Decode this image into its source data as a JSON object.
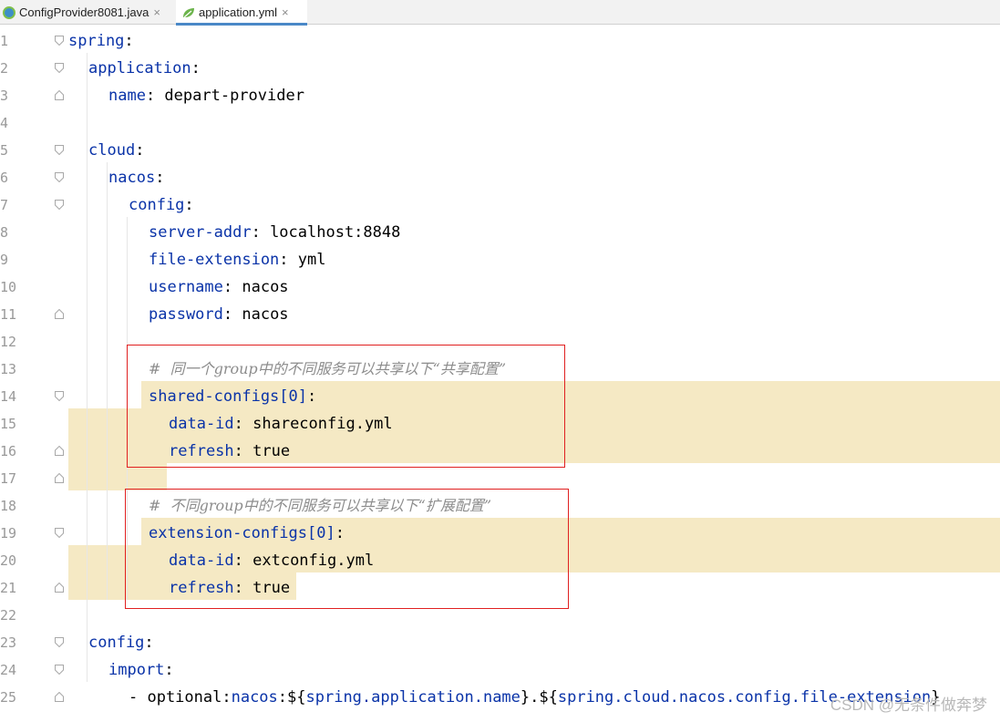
{
  "tabs": [
    {
      "label": "ConfigProvider8081.java",
      "active": false,
      "icon": "java-class-icon"
    },
    {
      "label": "application.yml",
      "active": true,
      "icon": "yaml-leaf-icon"
    }
  ],
  "close_glyph": "×",
  "lines": [
    {
      "n": "1",
      "indent": 0,
      "segs": [
        [
          "k",
          "spring"
        ],
        [
          "v",
          ":"
        ]
      ]
    },
    {
      "n": "2",
      "indent": 1,
      "segs": [
        [
          "k",
          "application"
        ],
        [
          "v",
          ":"
        ]
      ]
    },
    {
      "n": "3",
      "indent": 2,
      "segs": [
        [
          "k",
          "name"
        ],
        [
          "v",
          ": depart-provider"
        ]
      ]
    },
    {
      "n": "4",
      "indent": 0,
      "segs": []
    },
    {
      "n": "5",
      "indent": 1,
      "segs": [
        [
          "k",
          "cloud"
        ],
        [
          "v",
          ":"
        ]
      ]
    },
    {
      "n": "6",
      "indent": 2,
      "segs": [
        [
          "k",
          "nacos"
        ],
        [
          "v",
          ":"
        ]
      ]
    },
    {
      "n": "7",
      "indent": 3,
      "segs": [
        [
          "k",
          "config"
        ],
        [
          "v",
          ":"
        ]
      ]
    },
    {
      "n": "8",
      "indent": 4,
      "segs": [
        [
          "k",
          "server-addr"
        ],
        [
          "v",
          ": localhost:8848"
        ]
      ]
    },
    {
      "n": "9",
      "indent": 4,
      "segs": [
        [
          "k",
          "file-extension"
        ],
        [
          "v",
          ": yml"
        ]
      ]
    },
    {
      "n": "10",
      "indent": 4,
      "segs": [
        [
          "k",
          "username"
        ],
        [
          "v",
          ": nacos"
        ]
      ]
    },
    {
      "n": "11",
      "indent": 4,
      "segs": [
        [
          "k",
          "password"
        ],
        [
          "v",
          ": nacos"
        ]
      ]
    },
    {
      "n": "12",
      "indent": 0,
      "segs": []
    },
    {
      "n": "13",
      "indent": 4,
      "segs": [
        [
          "c",
          "#  同一个group中的不同服务可以共享以下“共享配置”"
        ]
      ]
    },
    {
      "n": "14",
      "indent": 4,
      "segs": [
        [
          "k",
          "shared-configs[0]"
        ],
        [
          "v",
          ":"
        ]
      ]
    },
    {
      "n": "15",
      "indent": 5,
      "segs": [
        [
          "k",
          "data-id"
        ],
        [
          "v",
          ": shareconfig.yml"
        ]
      ]
    },
    {
      "n": "16",
      "indent": 5,
      "segs": [
        [
          "k",
          "refresh"
        ],
        [
          "v",
          ": true"
        ]
      ]
    },
    {
      "n": "17",
      "indent": 0,
      "segs": []
    },
    {
      "n": "18",
      "indent": 4,
      "segs": [
        [
          "c",
          "#  不同group中的不同服务可以共享以下“扩展配置”"
        ]
      ]
    },
    {
      "n": "19",
      "indent": 4,
      "segs": [
        [
          "k",
          "extension-configs[0]"
        ],
        [
          "v",
          ":"
        ]
      ]
    },
    {
      "n": "20",
      "indent": 5,
      "segs": [
        [
          "k",
          "data-id"
        ],
        [
          "v",
          ": extconfig.yml"
        ]
      ]
    },
    {
      "n": "21",
      "indent": 5,
      "segs": [
        [
          "k",
          "refresh"
        ],
        [
          "v",
          ": true"
        ]
      ]
    },
    {
      "n": "22",
      "indent": 0,
      "segs": []
    },
    {
      "n": "23",
      "indent": 1,
      "segs": [
        [
          "k",
          "config"
        ],
        [
          "v",
          ":"
        ]
      ]
    },
    {
      "n": "24",
      "indent": 2,
      "segs": [
        [
          "k",
          "import"
        ],
        [
          "v",
          ":"
        ]
      ]
    },
    {
      "n": "25",
      "indent": 3,
      "segs": [
        [
          "v",
          "- optional:"
        ],
        [
          "k",
          "nacos"
        ],
        [
          "v",
          ":${"
        ],
        [
          "k",
          "spring.application.name"
        ],
        [
          "v",
          "}.${"
        ],
        [
          "k",
          "spring.cloud.nacos.config.file-extension"
        ],
        [
          "v",
          "}"
        ]
      ]
    }
  ],
  "watermark": "CSDN @无条件做奔梦",
  "colors": {
    "key": "#0a33a8",
    "comment": "#8c8c8c",
    "highlight": "#f5e9c4",
    "box": "#e02020",
    "tab_accent": "#4a88c7"
  }
}
